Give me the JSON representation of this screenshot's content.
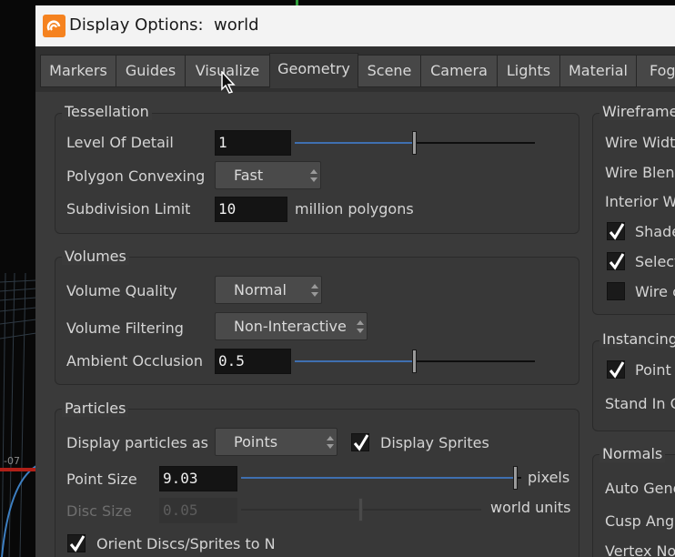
{
  "viewport": {
    "axis_label": "-07"
  },
  "dialog": {
    "title": "Display Options:  world",
    "tabs": [
      "Markers",
      "Guides",
      "Visualize",
      "Geometry",
      "Scene",
      "Camera",
      "Lights",
      "Material",
      "Fog"
    ],
    "active_tab": "Geometry"
  },
  "tessellation": {
    "title": "Tessellation",
    "level_of_detail_label": "Level Of Detail",
    "level_of_detail_value": "1",
    "level_of_detail_slider": 0.5,
    "polygon_convexing_label": "Polygon Convexing",
    "polygon_convexing_value": "Fast",
    "subdivision_limit_label": "Subdivision Limit",
    "subdivision_limit_value": "10",
    "subdivision_limit_unit": "million polygons"
  },
  "volumes": {
    "title": "Volumes",
    "volume_quality_label": "Volume Quality",
    "volume_quality_value": "Normal",
    "volume_filtering_label": "Volume Filtering",
    "volume_filtering_value": "Non-Interactive",
    "ambient_occlusion_label": "Ambient Occlusion",
    "ambient_occlusion_value": "0.5",
    "ambient_occlusion_slider": 0.5
  },
  "particles": {
    "title": "Particles",
    "display_as_label": "Display particles as",
    "display_as_value": "Points",
    "display_sprites_label": "Display Sprites",
    "display_sprites_checked": true,
    "point_size_label": "Point Size",
    "point_size_value": "9.03",
    "point_size_slider": 0.98,
    "point_size_unit": "pixels",
    "disc_size_label": "Disc Size",
    "disc_size_value": "0.05",
    "disc_size_slider": 0.5,
    "disc_size_unit": "world units",
    "orient_discs_label": "Orient Discs/Sprites to N",
    "orient_discs_checked": true
  },
  "wireframe": {
    "title": "Wireframe",
    "wire_width_label": "Wire Width",
    "wire_blend_label": "Wire Blenc",
    "interior_wire_label": "Interior Wi",
    "shade_label": "Shade",
    "shade_checked": true,
    "select_label": "Select",
    "select_checked": true,
    "wire_label": "Wire c",
    "wire_checked": false
  },
  "instancing": {
    "title": "Instancing",
    "point_label": "Point",
    "point_checked": true,
    "stand_in_label": "Stand In G"
  },
  "normals": {
    "title": "Normals",
    "auto_generate_label": "Auto Gene",
    "cusp_angle_label": "Cusp Angle",
    "vertex_normals_label": "Vertex Nor"
  },
  "colors": {
    "accent": "#3f6fb0",
    "brand": "#f5821f"
  }
}
